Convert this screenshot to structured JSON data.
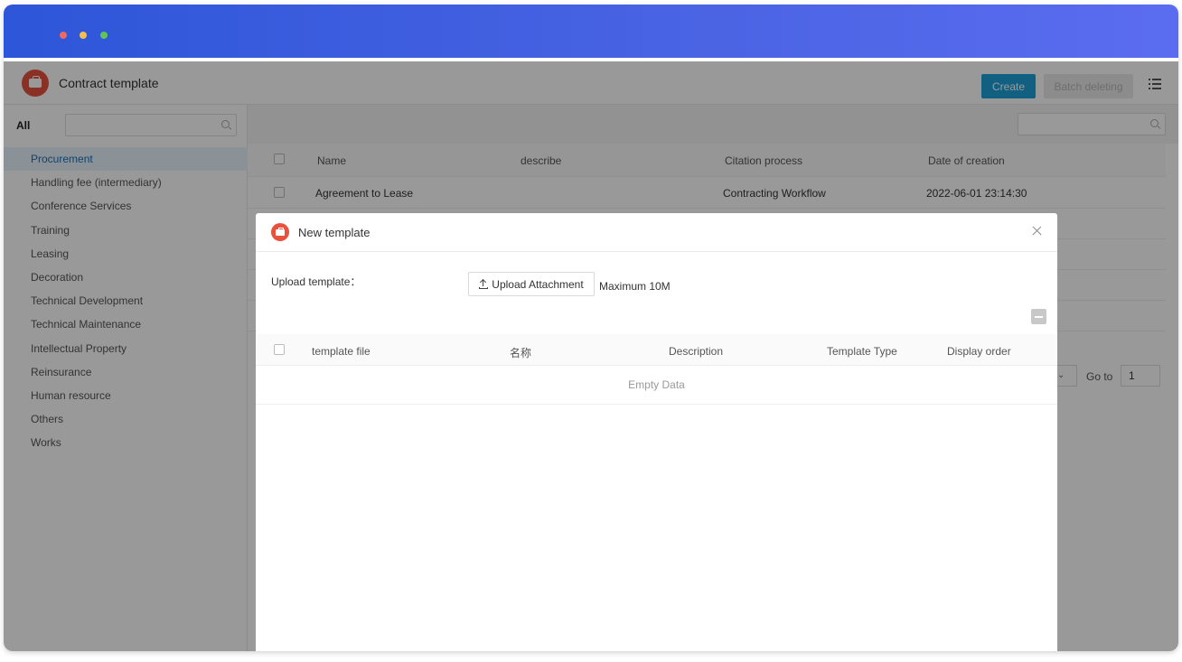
{
  "app": {
    "title": "Contract template",
    "create_label": "Create",
    "batch_delete_label": "Batch deleting"
  },
  "sidebar": {
    "all_label": "All",
    "items": [
      {
        "label": "Procurement",
        "active": true
      },
      {
        "label": "Handling fee (intermediary)"
      },
      {
        "label": "Conference Services"
      },
      {
        "label": "Training"
      },
      {
        "label": "Leasing"
      },
      {
        "label": "Decoration"
      },
      {
        "label": "Technical Development"
      },
      {
        "label": "Technical Maintenance"
      },
      {
        "label": "Intellectual Property"
      },
      {
        "label": "Reinsurance"
      },
      {
        "label": "Human resource"
      },
      {
        "label": "Others"
      },
      {
        "label": "Works"
      }
    ]
  },
  "table": {
    "columns": [
      "Name",
      "describe",
      "Citation process",
      "Date of creation"
    ],
    "rows": [
      {
        "name": "Agreement to Lease",
        "describe": "",
        "citation_process": "Contracting Workflow",
        "date": "2022-06-01 23:14:30"
      }
    ]
  },
  "pagination": {
    "goto_label": "Go to",
    "page_value": "1"
  },
  "modal": {
    "title": "New template",
    "upload_label": "Upload template：",
    "upload_button": "Upload Attachment",
    "max_size": "Maximum 10M",
    "columns": [
      "template file",
      "名称",
      "Description",
      "Template Type",
      "Display order"
    ],
    "empty_text": "Empty Data"
  },
  "colors": {
    "titlebar": "#2d56d8",
    "brand": "#e8513c",
    "primary": "#1d9fd8"
  }
}
